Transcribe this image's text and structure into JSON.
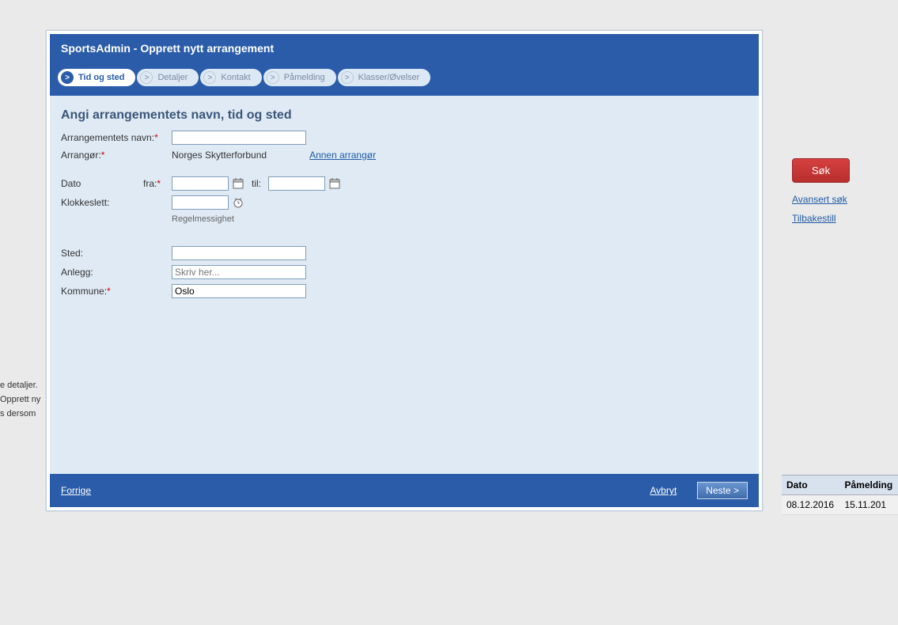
{
  "background": {
    "hints": [
      "e detaljer.",
      "Opprett ny",
      "s dersom"
    ],
    "search_button": "Søk",
    "advanced_link": "Avansert søk",
    "reset_link": "Tilbakestill",
    "table": {
      "headers": {
        "dato": "Dato",
        "pamelding": "Påmelding"
      },
      "rows": [
        {
          "dato": "08.12.2016",
          "pamelding": "15.11.201"
        }
      ]
    }
  },
  "modal": {
    "title": "SportsAdmin - Opprett nytt arrangement",
    "steps": [
      {
        "label": "Tid og sted",
        "active": true
      },
      {
        "label": "Detaljer",
        "active": false
      },
      {
        "label": "Kontakt",
        "active": false
      },
      {
        "label": "Påmelding",
        "active": false
      },
      {
        "label": "Klasser/Øvelser",
        "active": false
      }
    ],
    "body": {
      "title": "Angi arrangementets navn, tid og sted",
      "name_label": "Arrangementets navn:",
      "arrangor_label": "Arrangør:",
      "arrangor_value": "Norges Skytterforbund",
      "annen_arrangor": "Annen arrangør",
      "dato_label": "Dato",
      "fra_label": "fra:",
      "til_label": "til:",
      "klokkeslett_label": "Klokkeslett:",
      "regelmessighet": "Regelmessighet",
      "sted_label": "Sted:",
      "anlegg_label": "Anlegg:",
      "anlegg_placeholder": "Skriv her...",
      "kommune_label": "Kommune:",
      "kommune_value": "Oslo"
    },
    "footer": {
      "prev": "Forrige",
      "cancel": "Avbryt",
      "next": "Neste >"
    }
  }
}
